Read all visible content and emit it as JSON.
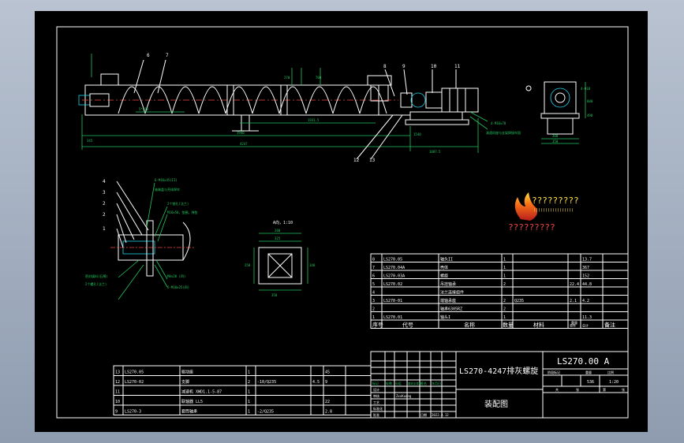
{
  "drawing": {
    "title_cn": "LS270-4247排灰螺旋",
    "title_sub": "装配图",
    "drawing_no": "LS270.00 A",
    "scale": "1:20",
    "mass": "536",
    "sheet_labels": [
      "阶段标记",
      "重量",
      "比例"
    ],
    "sheet_row2": [
      "共",
      "张",
      "第",
      "张"
    ],
    "revision_labels": [
      "标记",
      "处数",
      "分区",
      "更改文件号",
      "签名",
      "年月日"
    ],
    "role_labels": [
      "设计",
      "审核",
      "工艺",
      "标准化",
      "批准",
      "日期"
    ],
    "designer": "ZxxKuang",
    "date": "2022.3.12"
  },
  "logo": {
    "brand_line": "?????????",
    "tagline": "(((((((((((((((((",
    "sub_line": "?????????"
  },
  "upper_bom": {
    "headers": [
      "序号",
      "代号",
      "名称",
      "数量",
      "材料",
      "单件",
      "总计",
      "备注"
    ],
    "header_weight": "重量",
    "rows": [
      {
        "no": "8",
        "code": "LS270.05",
        "name": "轴头II",
        "qty": "1",
        "mat": "",
        "unit": "",
        "total": "13.7"
      },
      {
        "no": "7",
        "code": "LS270.04A",
        "name": "壳体",
        "qty": "1",
        "mat": "",
        "unit": "",
        "total": "367"
      },
      {
        "no": "6",
        "code": "LS270.03A",
        "name": "螺旋",
        "qty": "1",
        "mat": "",
        "unit": "",
        "total": "152"
      },
      {
        "no": "5",
        "code": "LS270.02",
        "name": "吊挂轴承",
        "qty": "2",
        "mat": "",
        "unit": "22.4",
        "total": "44.8"
      },
      {
        "no": "4",
        "code": "",
        "name": "法兰连接组件",
        "qty": "",
        "mat": "",
        "unit": "",
        "total": ""
      },
      {
        "no": "3",
        "code": "LS270-01",
        "name": "端轴承座",
        "qty": "2",
        "mat": "Q235",
        "unit": "2.1",
        "total": "4.2"
      },
      {
        "no": "2",
        "code": "",
        "name": "轴承6305RZ",
        "qty": "2",
        "mat": "",
        "unit": "",
        "total": ""
      },
      {
        "no": "1",
        "code": "LS270.01",
        "name": "轴头I",
        "qty": "1",
        "mat": "",
        "unit": "",
        "total": "11.3"
      }
    ]
  },
  "lower_bom": {
    "rows": [
      {
        "no": "13",
        "code": "LS270.05",
        "name": "驱动座",
        "qty": "1",
        "mat": "",
        "unit": "",
        "total": "45"
      },
      {
        "no": "12",
        "code": "LS270-02",
        "name": "支脚",
        "qty": "2",
        "mat": "-10/Q235",
        "unit": "4.5",
        "total": "9"
      },
      {
        "no": "11",
        "code": "",
        "name": "减速机 XWD1.1-5-87",
        "qty": "1",
        "mat": "",
        "unit": "",
        "total": ""
      },
      {
        "no": "10",
        "code": "",
        "name": "联轴器 LL5",
        "qty": "1",
        "mat": "",
        "unit": "",
        "total": "22"
      },
      {
        "no": "9",
        "code": "LS270-3",
        "name": "套筒轴承",
        "qty": "1",
        "mat": "-2/Q235",
        "unit": "",
        "total": "2.8"
      }
    ]
  },
  "main_view": {
    "part_callouts": [
      "6",
      "7",
      "8",
      "9",
      "10",
      "11",
      "12",
      "13"
    ],
    "dims": {
      "overall": "4247",
      "span": "3940",
      "pitch": "5*230",
      "mid": "1931.5",
      "side": "345",
      "foot": "1540",
      "drive": "1087.5",
      "h1": "270",
      "h2": "700"
    },
    "notes": [
      "4-M16x70",
      "减速机座与支架焊接牢固"
    ]
  },
  "side_view": {
    "dims": [
      "4-Ф18",
      "300",
      "350",
      "880",
      "490"
    ]
  },
  "detail_view": {
    "callouts": [
      "4",
      "3",
      "2",
      "2",
      "1"
    ],
    "notes": [
      "6-M16x45(II)",
      "轴端盖与壳体焊牢",
      "2个销孔(法兰)",
      "M16x50，垫圈，弹垫",
      "密封填料(石棉)",
      "2个螺孔(法兰)",
      "M8x20 (四)",
      "6-M10x25(四)"
    ]
  },
  "section_view": {
    "label": "A向，1:10",
    "dims": [
      "280",
      "325",
      "250",
      "350",
      "140"
    ]
  }
}
